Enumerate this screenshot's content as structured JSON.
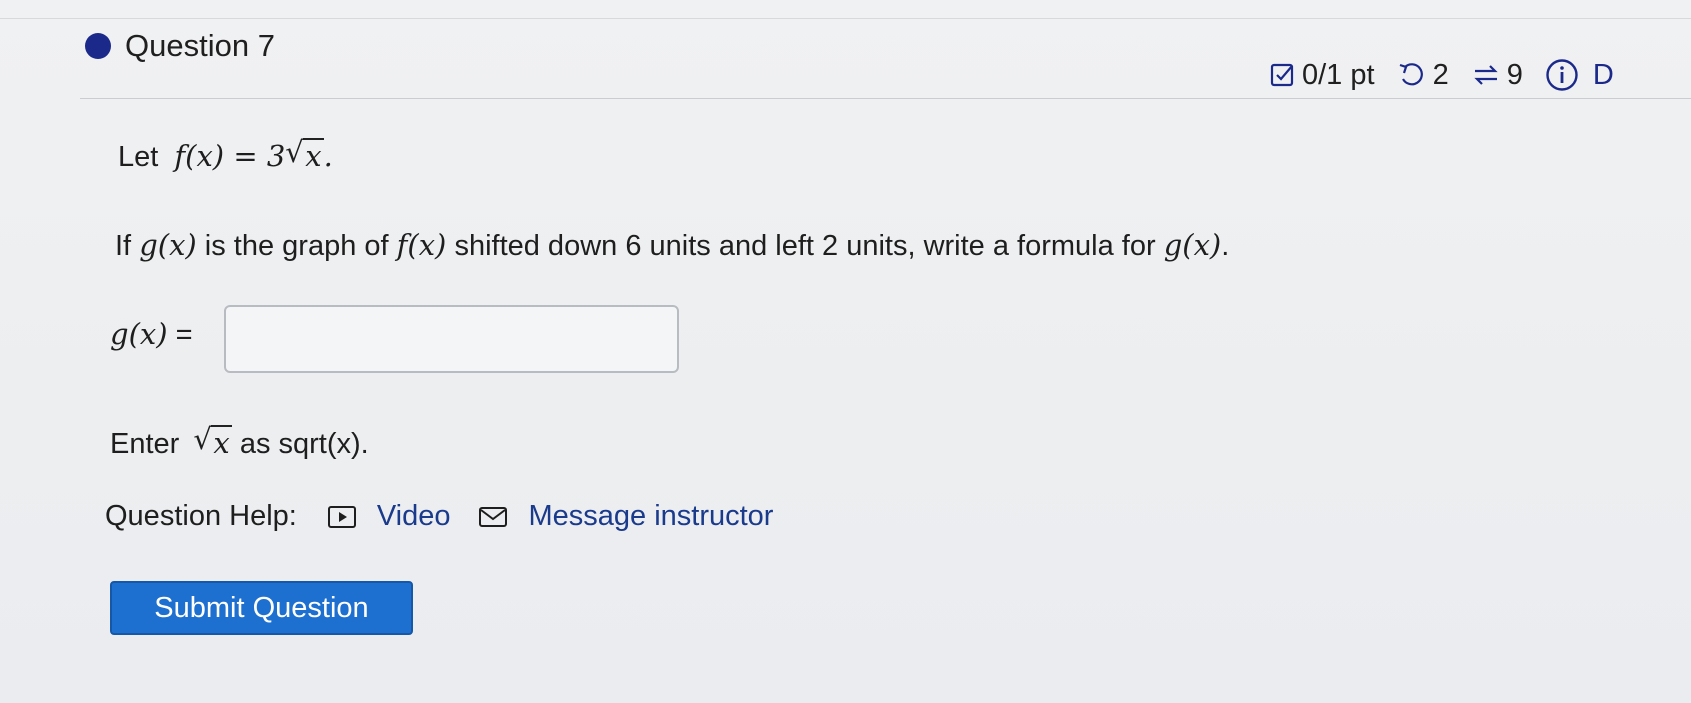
{
  "question": {
    "title": "Question 7",
    "score": "0/1 pt",
    "attempts": "2",
    "versions": "9",
    "details_partial": "D"
  },
  "problem": {
    "let_word": "Let",
    "f_def_lhs": "f(x) = 3",
    "f_def_radicand": "x",
    "f_def_end": ".",
    "if_word": "If",
    "g_expr": "g(x)",
    "middle_text": "is the graph of",
    "f_expr": "f(x)",
    "shift_text": "shifted down 6 units and left 2 units, write a formula for",
    "g_expr_end": "g(x)",
    "period": "."
  },
  "answer": {
    "label": "g(x)",
    "equals": "=",
    "value": "",
    "placeholder": ""
  },
  "hint": {
    "enter_word": "Enter",
    "radicand": "x",
    "as_text": "as sqrt(x)."
  },
  "help": {
    "label": "Question Help:",
    "video_label": "Video",
    "message_label": "Message instructor"
  },
  "submit": {
    "label": "Submit Question"
  },
  "colors": {
    "accent_blue": "#1d6fd0",
    "question_dot": "#1b2a8a"
  },
  "icons": [
    "checkbox-icon",
    "retry-icon",
    "versions-icon",
    "info-icon",
    "video-icon",
    "mail-icon"
  ]
}
